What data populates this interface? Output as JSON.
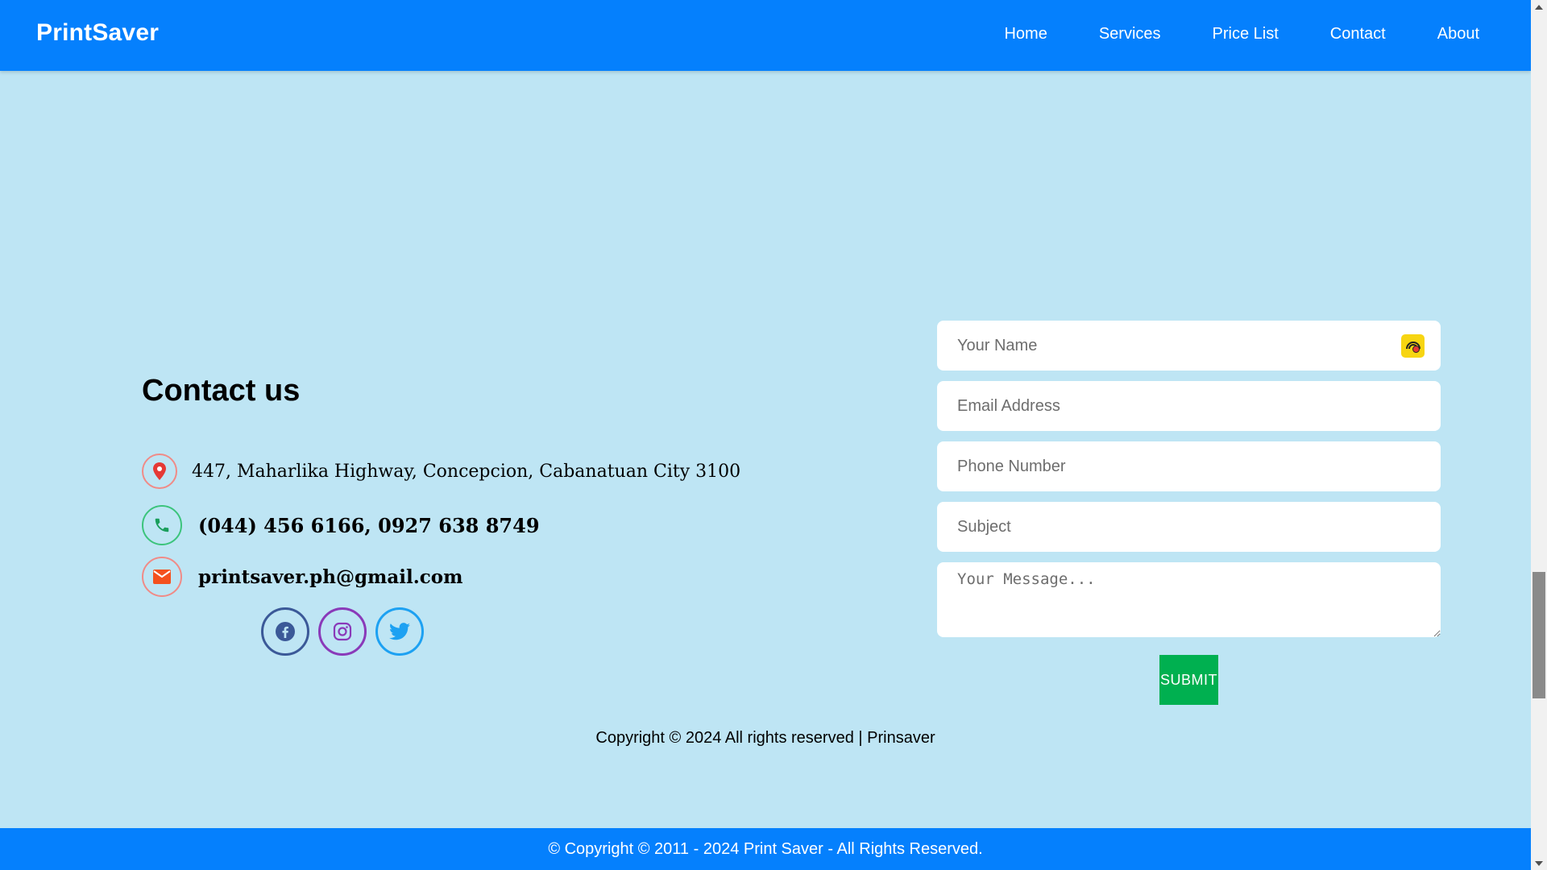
{
  "header": {
    "brand": "PrintSaver",
    "nav": [
      "Home",
      "Services",
      "Price List",
      "Contact",
      "About"
    ]
  },
  "contact": {
    "title": "Contact us",
    "address": "447, Maharlika Highway, Concepcion, Cabanatuan City 3100",
    "phone": "(044) 456 6166, 0927 638 8749",
    "email": "printsaver.ph@gmail.com",
    "socials": [
      "facebook-icon",
      "instagram-icon",
      "twitter-icon"
    ]
  },
  "form": {
    "name_placeholder": "Your Name",
    "email_placeholder": "Email Address",
    "phone_placeholder": "Phone Number",
    "subject_placeholder": "Subject",
    "message_placeholder": "Your Message...",
    "submit_label": "SUBMIT"
  },
  "copyright": "Copyright © 2024 All rights reserved | Prinsaver",
  "footer": "© Copyright © 2011 - 2024 Print Saver - All Rights Reserved.",
  "colors": {
    "primary": "#0580fd",
    "background": "#bee5f4",
    "submit": "#00b050"
  }
}
